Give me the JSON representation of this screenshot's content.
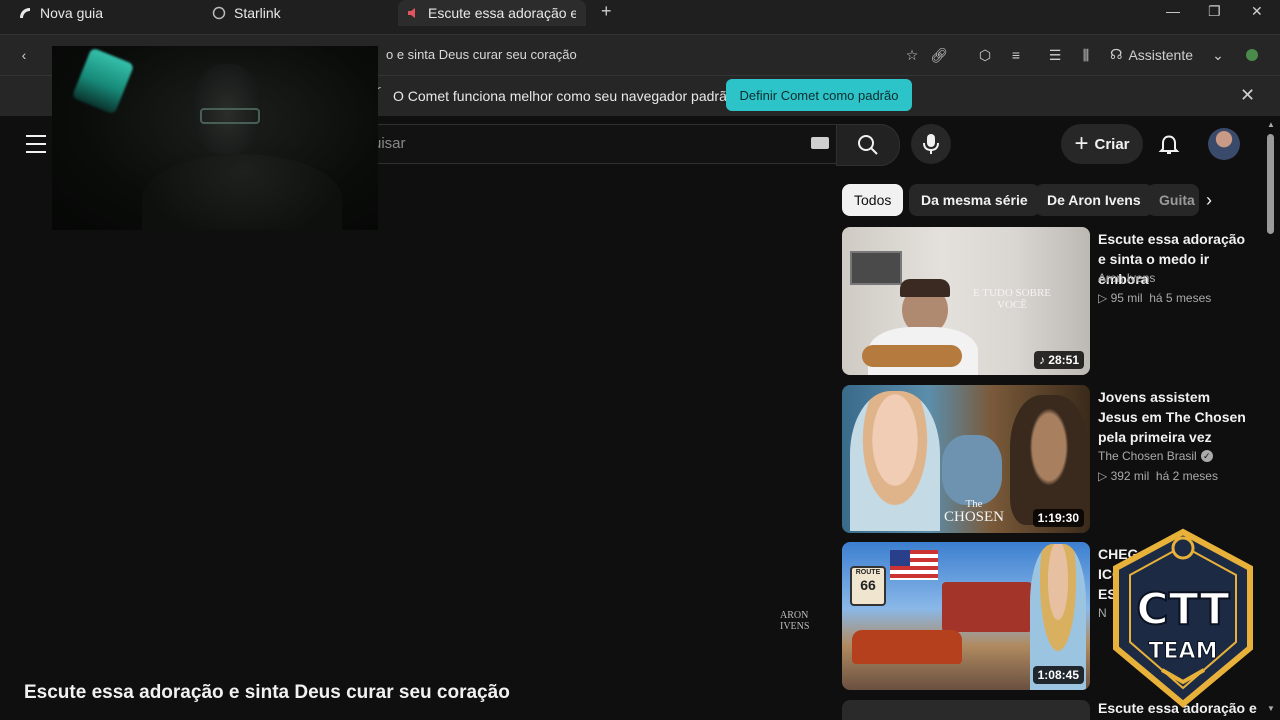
{
  "tabs": [
    {
      "label": "Nova guia"
    },
    {
      "label": "Starlink"
    },
    {
      "label": "Escute essa adoração e s"
    }
  ],
  "address_bar": {
    "url_text": "o e sinta Deus curar seu coração",
    "assistant_label": "Assistente"
  },
  "info_bar": {
    "message": "O Comet funciona melhor como seu navegador padrão",
    "button_label": "Definir Comet como padrão"
  },
  "header": {
    "search_placeholder": "uisar",
    "create_label": "Criar"
  },
  "video": {
    "title": "Escute essa adoração e sinta Deus curar seu coração",
    "watermark_line1": "ARON",
    "watermark_line2": "IVENS"
  },
  "chips": [
    {
      "label": "Todos"
    },
    {
      "label": "Da mesma série"
    },
    {
      "label": "De Aron Ivens"
    },
    {
      "label": "Guita"
    }
  ],
  "recommendations": [
    {
      "title": "Escute essa adoração e sinta o medo ir embora",
      "channel": "Aron Ivens",
      "verified": false,
      "views": "95 mil",
      "age": "há 5 meses",
      "duration": "28:51",
      "thumb_text": "E TUDO SOBRE VOCÊ"
    },
    {
      "title": "Jovens assistem Jesus em The Chosen pela primeira vez",
      "channel": "The Chosen Brasil",
      "verified": true,
      "views": "392 mil",
      "age": "há 2 meses",
      "duration": "1:19:30",
      "thumb_text1": "The",
      "thumb_text2": "CHOSEN"
    },
    {
      "title": "CHEG ICÔN EST",
      "channel": "N",
      "duration": "1:08:45",
      "thumb_text1": "ROUTE",
      "thumb_text2": "66"
    },
    {
      "title": "Escute essa adoração e"
    }
  ],
  "badge": {
    "line1": "CTT",
    "line2": "TEAM"
  },
  "colors": {
    "accent": "#2cc4c8",
    "background": "#0f0f0f",
    "chip": "#272727"
  }
}
